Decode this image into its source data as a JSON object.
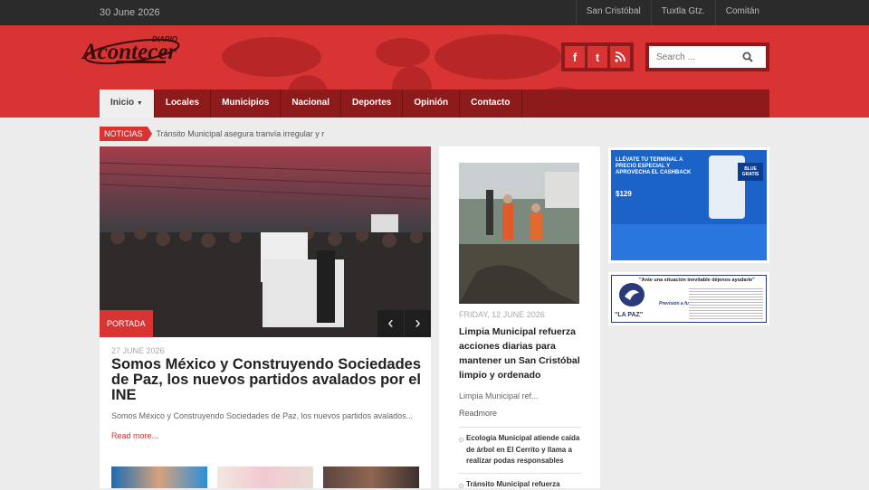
{
  "topbar": {
    "date": "30 June 2026",
    "cities": [
      "San Cristóbal",
      "Tuxtla Gtz.",
      "Comitán"
    ]
  },
  "header": {
    "logo_text": "Acontecer",
    "logo_tag": "DIARIO",
    "social_icons": [
      "facebook-icon",
      "twitter-icon",
      "rss-icon"
    ],
    "search_placeholder": "Search ..."
  },
  "nav": {
    "items": [
      "Inicio",
      "Locales",
      "Municipios",
      "Nacional",
      "Deportes",
      "Opinión",
      "Contacto"
    ]
  },
  "ticker": {
    "label": "NOTICIAS",
    "text": "Tránsito Municipal asegura tranvía irregular y r"
  },
  "featured": {
    "category": "PORTADA",
    "date": "27 JUNE 2026",
    "title": "Somos México y Construyendo Sociedades de Paz, los nuevos partidos avalados por el INE",
    "excerpt": "Somos México y Construyendo Sociedades de Paz, los nuevos partidos avalados...",
    "read_more": "Read more..."
  },
  "middle": {
    "date": "FRIDAY, 12 JUNE 2026",
    "title": "Limpia Municipal refuerza acciones diarias para mantener un San Cristóbal limpio y ordenado",
    "excerpt": "Limpia Municipal ref...",
    "read_more": "Readmore",
    "list": [
      "Ecología Municipal atiende caída de árbol en El Cerrito y llama a realizar podas responsables",
      "Tránsito Municipal refuerza"
    ]
  },
  "ads": {
    "ad1": {
      "headline": "LLÉVATE TU TERMINAL A PRECIO ESPECIAL Y APROVECHA EL CASHBACK",
      "price": "$129",
      "badge": "BLUE GRATIS"
    },
    "ad2": {
      "quote": "\"Ante una situación inevitable déjenos ayudarle\"",
      "name": "\"LA PAZ\"",
      "slogan": "Previsión a futuro"
    }
  },
  "colors": {
    "brand_red": "#d93434",
    "dark_red": "#8d1b1b",
    "topbar": "#2b2b2b"
  }
}
